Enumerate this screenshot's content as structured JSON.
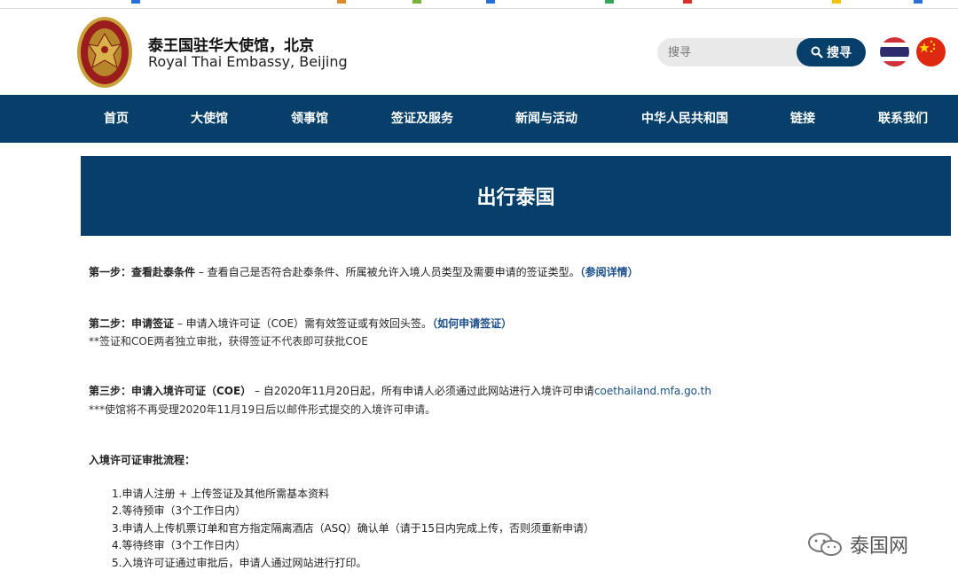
{
  "header": {
    "title_zh": "泰王国驻华大使馆，北京",
    "title_en": "Royal Thai Embassy, Beijing"
  },
  "search": {
    "placeholder": "搜寻",
    "button_label": "搜寻"
  },
  "nav": {
    "items": [
      "首页",
      "大使馆",
      "领事馆",
      "签证及服务",
      "新闻与活动",
      "中华人民共和国",
      "链接",
      "联系我们"
    ]
  },
  "banner": {
    "title": "出行泰国"
  },
  "step1": {
    "label": "第一步：查看赴泰条件",
    "text": " – 查看自己是否符合赴泰条件、所属被允许入境人员类型及需要申请的签证类型。",
    "link": "（参阅详情）"
  },
  "step2": {
    "label": "第二步：申请签证",
    "text": " – 申请入境许可证（COE）需有效签证或有效回头签。",
    "link": "（如何申请签证）",
    "note": "**签证和COE两者独立审批，获得签证不代表即可获批COE"
  },
  "step3": {
    "label": "第三步：申请入境许可证（COE）",
    "text": " – 自2020年11月20日起，所有申请人必须通过此网站进行入境许可申请",
    "url": "coethailand.mfa.go.th",
    "note": "***使馆将不再受理2020年11月19日后以邮件形式提交的入境许可申请。"
  },
  "process": {
    "heading": "入境许可证审批流程：",
    "steps": [
      "1.申请人注册 + 上传签证及其他所需基本资料",
      "2.等待预审（3个工作日内）",
      "3.申请人上传机票订单和官方指定隔离酒店（ASQ）确认单（请于15日内完成上传，否则须重新申请）",
      "4.等待终审（3个工作日内）",
      "5.入境许可证通过审批后，申请人通过网站进行打印。"
    ]
  },
  "watermark": {
    "text": "泰国网"
  },
  "colors": {
    "brand": "#063f6a",
    "link": "#1a4f8a"
  }
}
